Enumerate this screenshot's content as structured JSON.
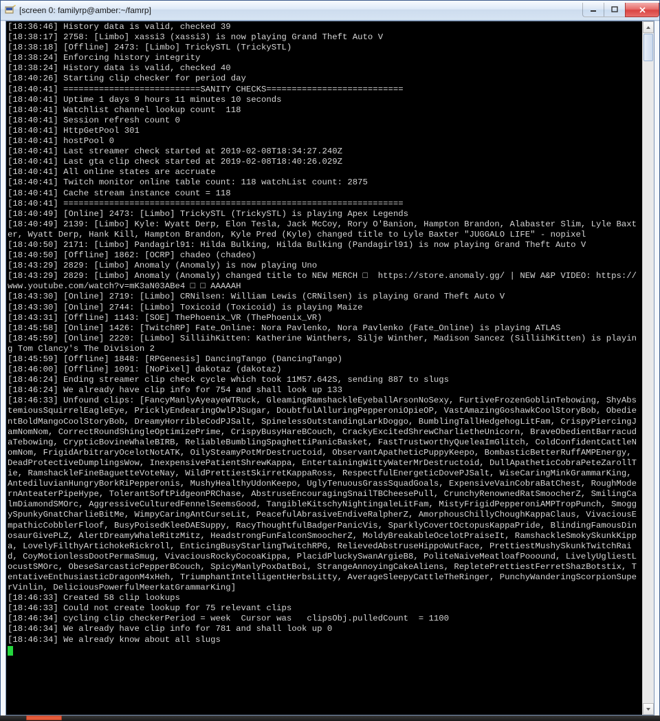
{
  "window": {
    "title": "[screen 0: familyrp@amber:~/famrp]"
  },
  "taskbar": {
    "items": [
      {
        "active": true
      }
    ]
  },
  "terminal_lines": [
    "[18:36:46] History data is valid, checked 39",
    "[18:38:17] 2758: [Limbo] xassi3 (xassi3) is now playing Grand Theft Auto V",
    "[18:38:18] [Offline] 2473: [Limbo] TrickySTL (TrickySTL)",
    "[18:38:24] Enforcing history integrity",
    "[18:38:24] History data is valid, checked 40",
    "[18:40:26] Starting clip checker for period day",
    "[18:40:41] ===========================SANITY CHECKS===========================",
    "[18:40:41] Uptime 1 days 9 hours 11 minutes 10 seconds",
    "[18:40:41] Watchlist channel lookup count  118",
    "[18:40:41] Session refresh count 0",
    "[18:40:41] HttpGetPool 301",
    "[18:40:41] hostPool 0",
    "[18:40:41] Last streamer check started at 2019-02-08T18:34:27.240Z",
    "[18:40:41] Last gta clip check started at 2019-02-08T18:40:26.029Z",
    "[18:40:41] All online states are accruate",
    "[18:40:41] Twitch monitor online table count: 118 watchList count: 2875",
    "[18:40:41] Cache stream instance count = 118",
    "[18:40:41] ===================================================================",
    "[18:40:49] [Online] 2473: [Limbo] TrickySTL (TrickySTL) is playing Apex Legends",
    "[18:40:49] 2139: [Limbo] Kyle: Wyatt Derp, Elon Tesla, Jack McCoy, Rory O'Banion, Hampton Brandon, Alabaster Slim, Lyle Baxter, Wyatt Derp, Hank Kill, Hampton Brandon, Kyle Pred (Kyle) changed title to Lyle Baxter \"JUGGALO LIFE\" - nopixel",
    "[18:40:50] 2171: [Limbo] Pandagirl91: Hilda Bulking, Hilda Bulking (Pandagirl91) is now playing Grand Theft Auto V",
    "[18:40:50] [Offline] 1862: [OCRP] chadeo (chadeo)",
    "[18:43:29] 2829: [Limbo] Anomaly (Anomaly) is now playing Uno",
    "[18:43:29] 2829: [Limbo] Anomaly (Anomaly) changed title to NEW MERCH □  https://store.anomaly.gg/ | NEW A&P VIDEO: https://www.youtube.com/watch?v=mK3aN03ABe4 □ □ AAAAAH",
    "[18:43:30] [Online] 2719: [Limbo] CRNilsen: William Lewis (CRNilsen) is playing Grand Theft Auto V",
    "[18:43:30] [Online] 2744: [Limbo] Toxicoid (Toxicoid) is playing Maize",
    "[18:43:31] [Offline] 1143: [SOE] ThePhoenix_VR (ThePhoenix_VR)",
    "[18:45:58] [Online] 1426: [TwitchRP] Fate_Online: Nora Pavlenko, Nora Pavlenko (Fate_Online) is playing ATLAS",
    "[18:45:59] [Online] 2220: [Limbo] SilliihKitten: Katherine Winthers, Silje Winther, Madison Sancez (SilliihKitten) is playing Tom Clancy's The Division 2",
    "[18:45:59] [Offline] 1848: [RPGenesis] DancingTango (DancingTango)",
    "[18:46:00] [Offline] 1091: [NoPixel] dakotaz (dakotaz)",
    "[18:46:24] Ending streamer clip check cycle which took 11M57.642S, sending 887 to slugs",
    "[18:46:24] We already have clip info for 754 and shall look up 133",
    "[18:46:33] Unfound clips: [FancyManlyAyeayeWTRuck, GleamingRamshackleEyeballArsonNoSexy, FurtiveFrozenGoblinTebowing, ShyAbstemiousSquirrelEagleEye, PricklyEndearingOwlPJSugar, DoubtfulAlluringPepperoniOpieOP, VastAmazingGoshawkCoolStoryBob, ObedientBoldMangoCoolStoryBob, DreamyHorribleCodPJSalt, SpinelessOutstandingLarkDoggo, BumblingTallHedgehogLitFam, CrispyPiercingJamNomNom, CorrectRoundShingleOptimizePrime, CrispyBusyHareBCouch, CrackyExcitedShrewCharlietheUnicorn, BraveObedientBarracudaTebowing, CrypticBovineWhaleBIRB, ReliableBumblingSpaghettiPanicBasket, FastTrustworthyQueleaImGlitch, ColdConfidentCattleNomNom, FrigidArbitraryOcelotNotATK, OilySteamyPotMrDestructoid, ObservantApatheticPuppyKeepo, BombasticBetterRuffAMPEnergy, DeadProtectiveDumplingsWow, InexpensivePatientShrewKappa, EntertainingWittyWaterMrDestructoid, DullApatheticCobraPeteZarollTie, RamshackleFineBaguetteVoteNay, WildPrettiestSkirretKappaRoss, RespectfulEnergeticDovePJSalt, WiseCaringMinkGrammarKing, AntediluvianHungryBorkRiPepperonis, MushyHealthyUdonKeepo, UglyTenuousGrassSquadGoals, ExpensiveVainCobraBatChest, RoughModernAnteaterPipeHype, TolerantSoftPidgeonPRChase, AbstruseEncouragingSnailTBCheesePull, CrunchyRenownedRatSmoocherZ, SmilingCalmDiamondSMOrc, AggressiveCulturedFennelSeemsGood, TangibleKitschyNightingaleLitFam, MistyFrigidPepperoniAMPTropPunch, SmoggySpunkyGnatCharlieBitMe, WimpyCaringAntCurseLit, PeacefulAbrasiveEndiveRalpherZ, AmorphousChillyChoughKappaClaus, VivaciousEmpathicCobblerFloof, BusyPoisedKleeDAESuppy, RacyThoughtfulBadgerPanicVis, SparklyCovertOctopusKappaPride, BlindingFamousDinosaurGivePLZ, AlertDreamyWhaleRitzMitz, HeadstrongFunFalconSmoocherZ, MoldyBreakableOcelotPraiseIt, RamshackleSmokySkunkKippa, LovelyFilthyArtichokeRickroll, EnticingBusyStarlingTwitchRPG, RelievedAbstruseHippoWutFace, PrettiestMushySkunkTwitchRaid, CoyMotionlessDootPermaSmug, VivaciousRockyCocoaKippa, PlacidPluckySwanArgieB8, PoliteNaiveMeatloafPooound, LivelyUgliestLocustSMOrc, ObeseSarcasticPepperBCouch, SpicyManlyPoxDatBoi, StrangeAnnoyingCakeAliens, RepletePrettiestFerretShazBotstix, TentativeEnthusiasticDragonM4xHeh, TriumphantIntelligentHerbsLitty, AverageSleepyCattleTheRinger, PunchyWanderingScorpionSuperVinlin, DeliciousPowerfulMeerkatGrammarKing]",
    "[18:46:33] Created 58 clip lookups",
    "[18:46:33] Could not create lookup for 75 relevant clips",
    "[18:46:34] cycling clip checkerPeriod = week  Cursor was   clipsObj.pulledCount  = 1100",
    "[18:46:34] We already have clip info for 781 and shall look up 0",
    "[18:46:34] We already know about all slugs"
  ]
}
